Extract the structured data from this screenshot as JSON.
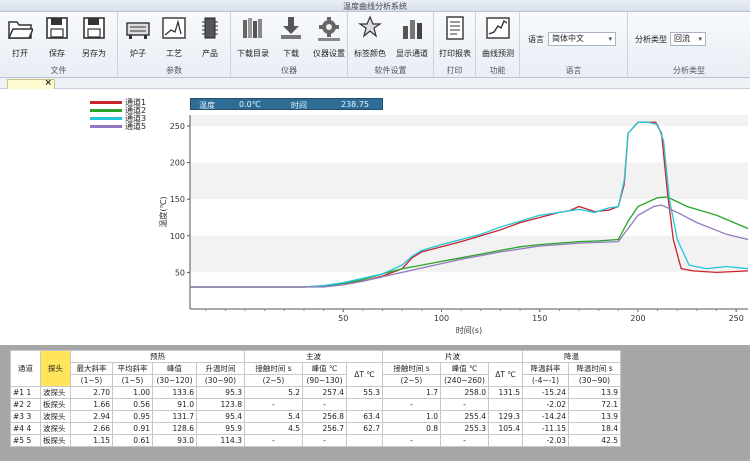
{
  "window": {
    "title": "温度曲线分析系统"
  },
  "ribbon": {
    "groups": [
      {
        "label": "文件",
        "buttons": [
          "打开",
          "保存",
          "另存为"
        ]
      },
      {
        "label": "参数",
        "buttons": [
          "炉子",
          "工艺",
          "产品"
        ]
      },
      {
        "label": "仪器",
        "buttons": [
          "下载目录",
          "下载",
          "仪器设置"
        ]
      },
      {
        "label": "软件设置",
        "buttons": [
          "标签颜色",
          "显示通道"
        ]
      },
      {
        "label": "打印",
        "buttons": [
          "打印报表"
        ]
      },
      {
        "label": "功能",
        "buttons": [
          "曲线预测"
        ]
      },
      {
        "label": "语言"
      },
      {
        "label": "分析类型"
      }
    ],
    "language_label": "语言",
    "language_value": "简体中文",
    "analysis_label": "分析类型",
    "analysis_value": "回流"
  },
  "tab": {
    "close": "×"
  },
  "readout": {
    "temp_label": "温度",
    "temp_value": "0.0℃",
    "time_label": "时间",
    "time_value": "238.75"
  },
  "chart_data": {
    "type": "line",
    "ylabel": "温度(℃)",
    "xlabel": "时间(s)",
    "xlim": [
      -28,
      256
    ],
    "ylim": [
      0,
      265
    ],
    "xticks": [
      50,
      100,
      150,
      200,
      250
    ],
    "yticks": [
      50,
      100,
      150,
      200,
      250
    ],
    "grid": "horizontal bands",
    "legend": "top-left",
    "series": [
      {
        "name": "通道1",
        "color": "#c8242c",
        "points": [
          [
            -28,
            30
          ],
          [
            0,
            30
          ],
          [
            30,
            30
          ],
          [
            40,
            32
          ],
          [
            50,
            35
          ],
          [
            60,
            38
          ],
          [
            70,
            45
          ],
          [
            80,
            55
          ],
          [
            85,
            70
          ],
          [
            90,
            78
          ],
          [
            100,
            85
          ],
          [
            110,
            92
          ],
          [
            120,
            100
          ],
          [
            130,
            108
          ],
          [
            140,
            118
          ],
          [
            150,
            125
          ],
          [
            160,
            132
          ],
          [
            165,
            134
          ],
          [
            170,
            140
          ],
          [
            178,
            133
          ],
          [
            185,
            135
          ],
          [
            190,
            140
          ],
          [
            193,
            170
          ],
          [
            195,
            240
          ],
          [
            200,
            255
          ],
          [
            205,
            255
          ],
          [
            209,
            255
          ],
          [
            212,
            240
          ],
          [
            215,
            160
          ],
          [
            218,
            95
          ],
          [
            222,
            55
          ],
          [
            228,
            52
          ],
          [
            240,
            50
          ],
          [
            256,
            52
          ]
        ]
      },
      {
        "name": "通道2",
        "color": "#2aa52a",
        "points": [
          [
            -28,
            30
          ],
          [
            0,
            30
          ],
          [
            30,
            30
          ],
          [
            40,
            31
          ],
          [
            50,
            35
          ],
          [
            60,
            40
          ],
          [
            70,
            48
          ],
          [
            80,
            55
          ],
          [
            90,
            60
          ],
          [
            100,
            65
          ],
          [
            110,
            70
          ],
          [
            120,
            75
          ],
          [
            130,
            80
          ],
          [
            140,
            85
          ],
          [
            150,
            88
          ],
          [
            160,
            90
          ],
          [
            170,
            92
          ],
          [
            180,
            93
          ],
          [
            190,
            95
          ],
          [
            195,
            120
          ],
          [
            200,
            140
          ],
          [
            210,
            152
          ],
          [
            215,
            153
          ],
          [
            225,
            140
          ],
          [
            240,
            128
          ],
          [
            256,
            110
          ]
        ]
      },
      {
        "name": "通道3",
        "color": "#22c7d8",
        "points": [
          [
            -28,
            30
          ],
          [
            0,
            30
          ],
          [
            30,
            30
          ],
          [
            40,
            32
          ],
          [
            50,
            36
          ],
          [
            60,
            42
          ],
          [
            70,
            48
          ],
          [
            80,
            60
          ],
          [
            85,
            72
          ],
          [
            90,
            80
          ],
          [
            100,
            88
          ],
          [
            110,
            95
          ],
          [
            120,
            102
          ],
          [
            130,
            112
          ],
          [
            140,
            120
          ],
          [
            150,
            128
          ],
          [
            160,
            132
          ],
          [
            170,
            136
          ],
          [
            178,
            132
          ],
          [
            185,
            138
          ],
          [
            190,
            140
          ],
          [
            193,
            175
          ],
          [
            195,
            240
          ],
          [
            200,
            255
          ],
          [
            205,
            255
          ],
          [
            210,
            252
          ],
          [
            213,
            230
          ],
          [
            216,
            150
          ],
          [
            220,
            95
          ],
          [
            226,
            60
          ],
          [
            235,
            55
          ],
          [
            245,
            58
          ],
          [
            256,
            55
          ]
        ]
      },
      {
        "name": "通道5",
        "color": "#9378bf",
        "points": [
          [
            -28,
            30
          ],
          [
            0,
            30
          ],
          [
            30,
            30
          ],
          [
            40,
            30
          ],
          [
            50,
            33
          ],
          [
            60,
            38
          ],
          [
            70,
            44
          ],
          [
            80,
            50
          ],
          [
            90,
            56
          ],
          [
            100,
            62
          ],
          [
            110,
            68
          ],
          [
            120,
            73
          ],
          [
            130,
            78
          ],
          [
            140,
            82
          ],
          [
            150,
            86
          ],
          [
            160,
            88
          ],
          [
            170,
            90
          ],
          [
            180,
            91
          ],
          [
            190,
            92
          ],
          [
            195,
            110
          ],
          [
            200,
            128
          ],
          [
            208,
            140
          ],
          [
            212,
            142
          ],
          [
            220,
            132
          ],
          [
            230,
            118
          ],
          [
            245,
            102
          ],
          [
            256,
            95
          ]
        ]
      }
    ]
  },
  "table": {
    "header_groups": [
      "预热",
      "主波",
      "片波",
      "降温"
    ],
    "col_headers": [
      "通道",
      "探头",
      "最大斜率",
      "平均斜率",
      "峰值",
      "升温时间",
      "接触时间 s",
      "峰值 ℃",
      "ΔT ℃",
      "接触时间 s",
      "峰值 ℃",
      "ΔT ℃",
      "降温斜率",
      "降温时间 s"
    ],
    "units": [
      "(1~5)",
      "(1~5)",
      "(30~120)",
      "(30~90)",
      "(2~5)",
      "(90~130)",
      "(2~5)",
      "(240~260)",
      "(-4~-1)",
      "(30~90)"
    ],
    "rows": [
      [
        "#1 1",
        "波探头",
        "2.70",
        "1.00",
        "133.6",
        "95.3",
        "5.2",
        "257.4",
        "55.3",
        "1.7",
        "258.0",
        "131.5",
        "-15.24",
        "13.9"
      ],
      [
        "#2 2",
        "板探头",
        "1.66",
        "0.56",
        "91.0",
        "123.8",
        "-",
        "-",
        "",
        "-",
        "-",
        "",
        "-2.02",
        "72.1"
      ],
      [
        "#3 3",
        "波探头",
        "2.94",
        "0.95",
        "131.7",
        "95.4",
        "5.4",
        "256.8",
        "63.4",
        "1.0",
        "255.4",
        "129.3",
        "-14.24",
        "13.9"
      ],
      [
        "#4 4",
        "波探头",
        "2.66",
        "0.91",
        "128.6",
        "95.9",
        "4.5",
        "256.7",
        "62.7",
        "0.8",
        "255.3",
        "105.4",
        "-11.15",
        "18.4"
      ],
      [
        "#5 5",
        "板探头",
        "1.15",
        "0.61",
        "93.0",
        "114.3",
        "-",
        "-",
        "",
        "-",
        "-",
        "",
        "-2.03",
        "42.5"
      ]
    ]
  }
}
